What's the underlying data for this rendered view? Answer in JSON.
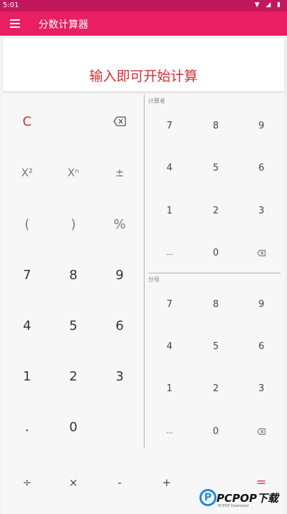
{
  "status": {
    "time": "5:01",
    "icons": "▼ ◢ ▮"
  },
  "appbar": {
    "title": "分数计算器"
  },
  "display": {
    "text": "输入即可开始计算"
  },
  "left": {
    "clear": "C",
    "square": "X²",
    "power": "Xⁿ",
    "plusminus": "±",
    "lparen": "(",
    "rparen": ")",
    "percent": "%",
    "d7": "7",
    "d8": "8",
    "d9": "9",
    "d4": "4",
    "d5": "5",
    "d6": "6",
    "d1": "1",
    "d2": "2",
    "d3": "3",
    "dot": ".",
    "d0": "0"
  },
  "numerator": {
    "label": "计算者",
    "d7": "7",
    "d8": "8",
    "d9": "9",
    "d4": "4",
    "d5": "5",
    "d6": "6",
    "d1": "1",
    "d2": "2",
    "d3": "3",
    "ellipsis": "...",
    "d0": "0"
  },
  "denominator": {
    "label": "分母",
    "d7": "7",
    "d8": "8",
    "d9": "9",
    "d4": "4",
    "d5": "5",
    "d6": "6",
    "d1": "1",
    "d2": "2",
    "d3": "3",
    "ellipsis": "...",
    "d0": "0"
  },
  "operators": {
    "divide": "÷",
    "multiply": "×",
    "minus": "-",
    "plus": "+",
    "equals": "="
  },
  "watermark": {
    "badge": "P",
    "brand": "PCPOP下载",
    "sub": "PCPOP Download"
  },
  "colors": {
    "statusbar": "#c2185b",
    "appbar": "#e91e63",
    "accent_red": "#d32f2f"
  }
}
